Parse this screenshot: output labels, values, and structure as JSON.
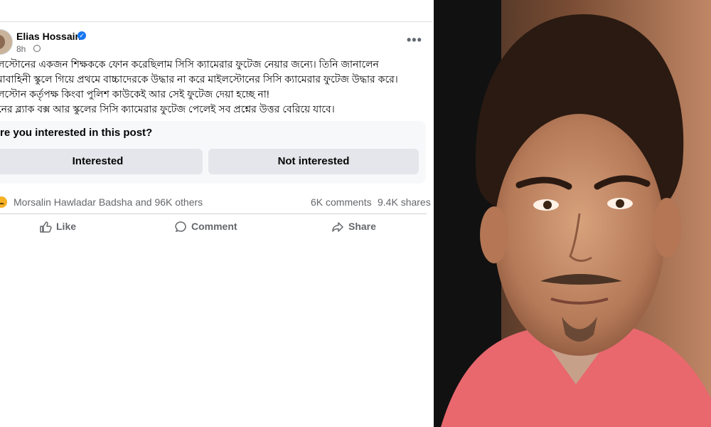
{
  "post": {
    "author": "Elias Hossain",
    "time": "8h",
    "lines": [
      "লস্টোনের একজন শিক্ষককে ফোন করেছিলাম সিসি ক্যামেরার ফুটেজ নেয়ার জন্যে। তিনি জানালেন",
      "মাবাহিনী স্কুলে গিয়ে প্রথমে বাচ্চাদেরকে উদ্ধার না করে মাইলস্টোনের সিসি ক্যামেরার ফুটেজ উদ্ধার করে।",
      "লস্টোন কর্তৃপক্ষ কিংবা পুলিশ কাউকেই আর সেই ফুটেজ দেয়া হচ্ছে না!",
      "নের ব্ল্যাক বক্স আর স্কুলের সিসি ক্যামেরার ফুটেজ পেলেই সব প্রশ্নের উত্তর বেরিয়ে যাবে।"
    ]
  },
  "interest": {
    "question": "re you interested in this post?",
    "yes_label": "Interested",
    "no_label": "Not interested"
  },
  "stats": {
    "reactions": "Morsalin Hawladar Badsha and 96K others",
    "comments": "6K comments",
    "shares": "9.4K shares"
  },
  "actions": {
    "like": "Like",
    "comment": "Comment",
    "share": "Share"
  },
  "icons": [
    "verified-badge-icon",
    "globe-icon",
    "more-options-icon",
    "like-icon",
    "comment-icon",
    "share-icon",
    "sad-reaction-icon"
  ],
  "colors": {
    "accent": "#1877f2",
    "muted": "#65676b"
  }
}
